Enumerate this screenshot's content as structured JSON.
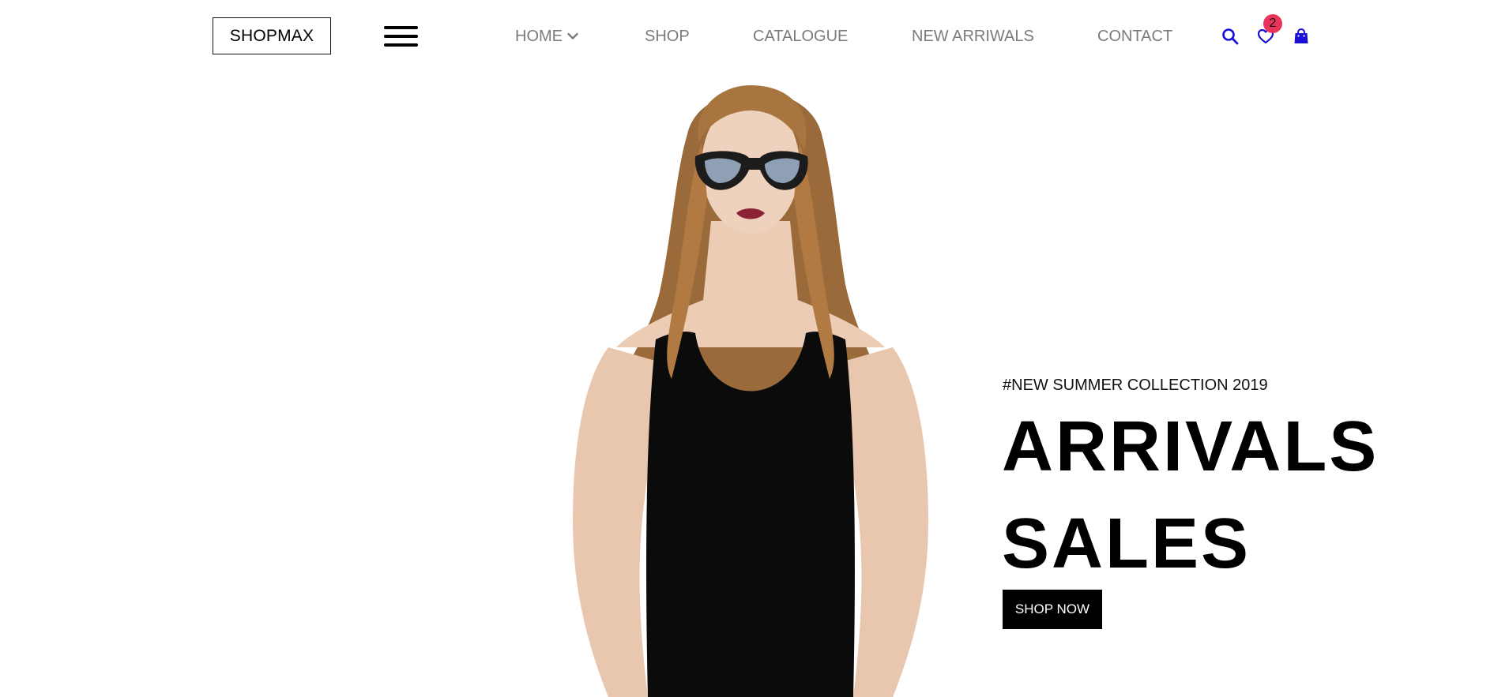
{
  "header": {
    "logo": "SHOPMAX",
    "nav": {
      "home": "HOME",
      "shop": "SHOP",
      "catalogue": "CATALOGUE",
      "new_arrivals": "NEW ARRIWALS",
      "contact": "CONTACT"
    },
    "icons": {
      "search": "search-icon",
      "wishlist": "heart-icon",
      "cart": "shopping-bag-icon",
      "menu": "hamburger-menu-icon"
    },
    "wishlist_count": "2"
  },
  "hero": {
    "tagline": "#NEW SUMMER COLLECTION 2019",
    "headline_line1": "ARRIVALS",
    "headline_line2": "SALES",
    "cta_label": "SHOP NOW"
  },
  "colors": {
    "accent_icon": "#1a0fd6",
    "badge": "#e8345a",
    "nav_text": "#7b7b7b",
    "cta_bg": "#000000"
  }
}
